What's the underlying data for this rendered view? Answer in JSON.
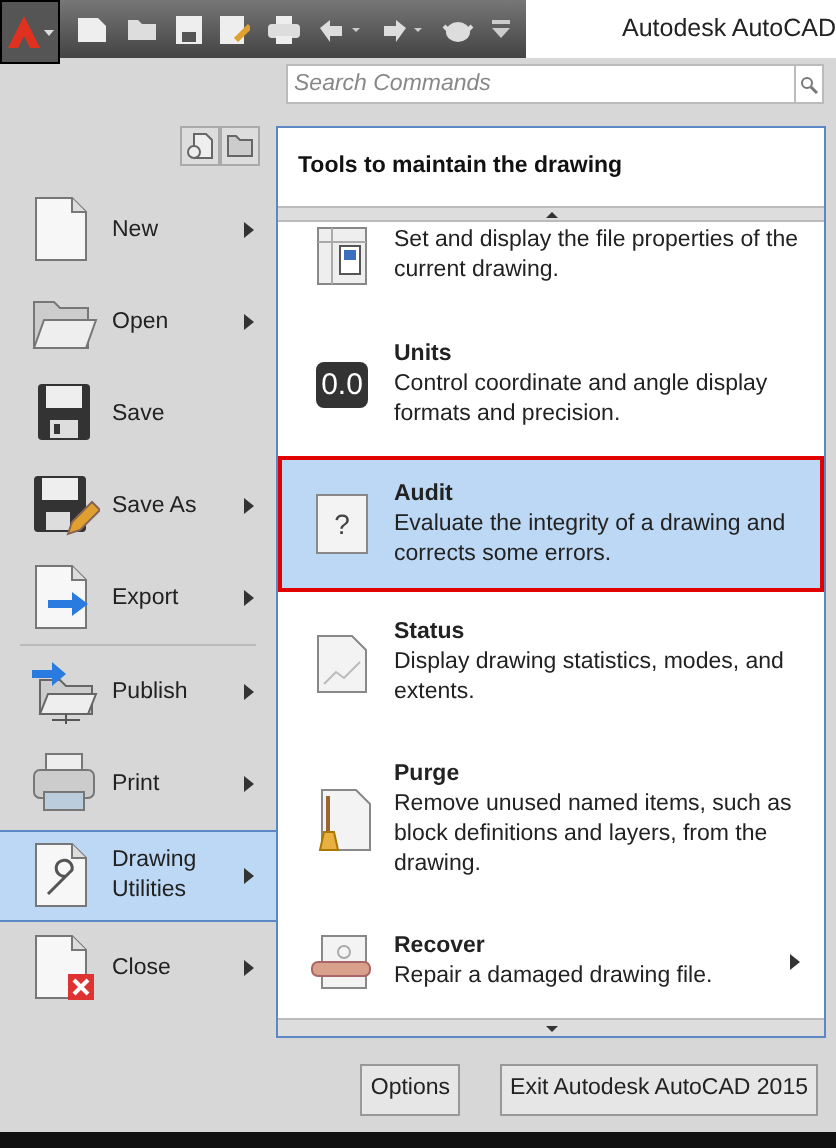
{
  "window": {
    "title": "Autodesk AutoCAD"
  },
  "search": {
    "placeholder": "Search Commands"
  },
  "menu": [
    {
      "label": "New",
      "submenu": true,
      "selected": false
    },
    {
      "label": "Open",
      "submenu": true,
      "selected": false
    },
    {
      "label": "Save",
      "submenu": false,
      "selected": false
    },
    {
      "label": "Save As",
      "submenu": true,
      "selected": false
    },
    {
      "label": "Export",
      "submenu": true,
      "selected": false
    },
    {
      "label": "Publish",
      "submenu": true,
      "selected": false
    },
    {
      "label": "Print",
      "submenu": true,
      "selected": false
    },
    {
      "label": "Drawing Utilities",
      "submenu": true,
      "selected": true
    },
    {
      "label": "Close",
      "submenu": true,
      "selected": false
    }
  ],
  "panel": {
    "heading": "Tools to maintain the drawing",
    "items": [
      {
        "kind": "properties",
        "description": "Set and display the file properties of the current drawing.",
        "selected": false,
        "submenu": false
      },
      {
        "kind": "units",
        "title": "Units",
        "icon_text": "0.0",
        "description": "Control coordinate and angle display formats and precision.",
        "selected": false,
        "submenu": false
      },
      {
        "kind": "audit",
        "title": "Audit",
        "icon_text": "?",
        "description": "Evaluate the integrity of a drawing and corrects some errors.",
        "selected": true,
        "submenu": false
      },
      {
        "kind": "status",
        "title": "Status",
        "description": "Display drawing statistics, modes, and extents.",
        "selected": false,
        "submenu": false
      },
      {
        "kind": "purge",
        "title": "Purge",
        "description": "Remove unused named items, such as block definitions and layers, from the drawing.",
        "selected": false,
        "submenu": false
      },
      {
        "kind": "recover",
        "title": "Recover",
        "description": "Repair a damaged drawing file.",
        "selected": false,
        "submenu": true
      }
    ]
  },
  "buttons": [
    "Options",
    "Exit Autodesk AutoCAD 2015"
  ]
}
